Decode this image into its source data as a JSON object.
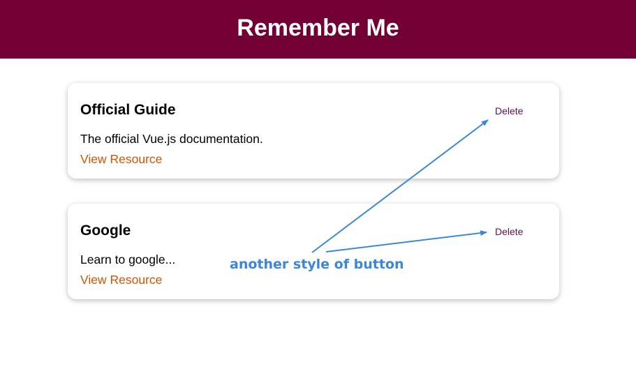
{
  "header": {
    "title": "Remember Me",
    "background": "#720034"
  },
  "resources": [
    {
      "title": "Official Guide",
      "description": "The official Vue.js documentation.",
      "link_label": "View Resource",
      "delete_label": "Delete"
    },
    {
      "title": "Google",
      "description": "Learn to google...",
      "link_label": "View Resource",
      "delete_label": "Delete"
    }
  ],
  "annotation": {
    "text": "another style of button",
    "color": "#3b87d6"
  },
  "colors": {
    "link": "#d35400",
    "delete": "#5b0f55"
  }
}
